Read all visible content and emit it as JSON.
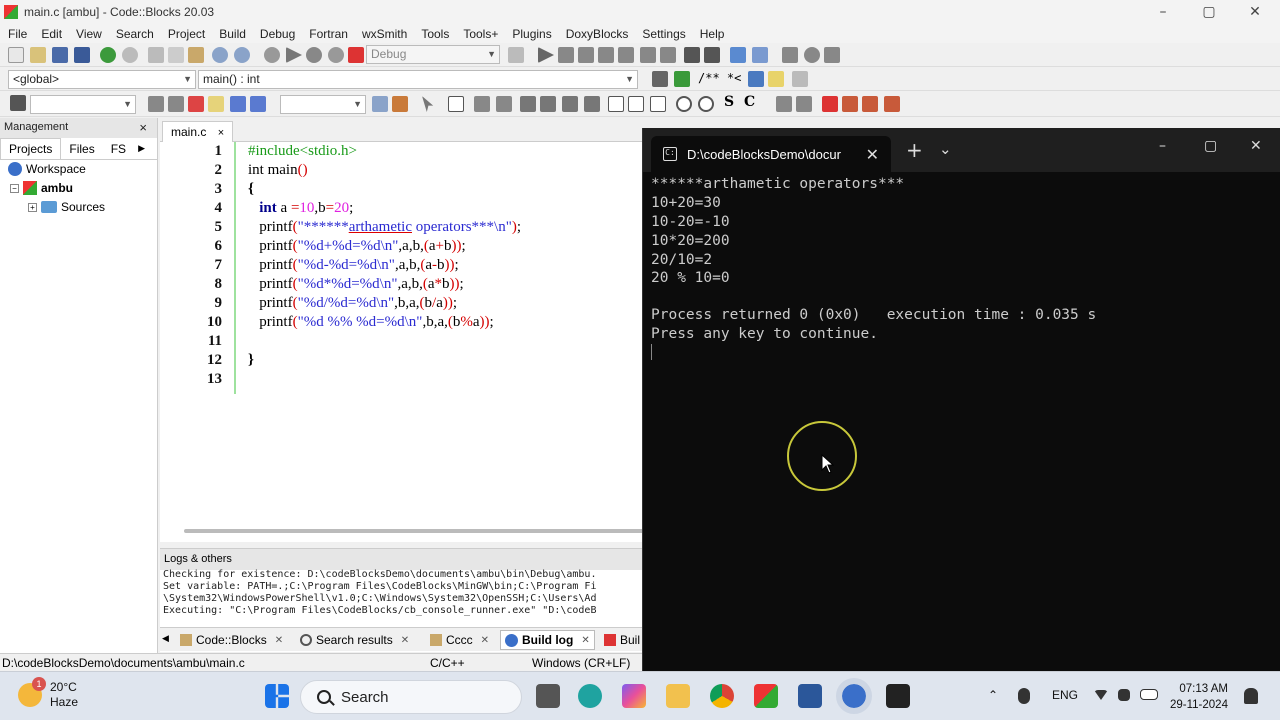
{
  "window": {
    "title": "main.c [ambu] - Code::Blocks 20.03",
    "controls": [
      "–",
      "▢",
      "✕"
    ]
  },
  "menu": [
    "File",
    "Edit",
    "View",
    "Search",
    "Project",
    "Build",
    "Debug",
    "Fortran",
    "wxSmith",
    "Tools",
    "Tools+",
    "Plugins",
    "DoxyBlocks",
    "Settings",
    "Help"
  ],
  "toolbar": {
    "build_target": "Debug",
    "scope": "<global>",
    "function": "main() : int",
    "doxy_comment": "/** *<",
    "search_value": "",
    "find_value": "",
    "s_label": "S",
    "c_label": "C"
  },
  "management": {
    "title": "Management",
    "close": "×",
    "tabs": [
      "Projects",
      "Files",
      "FS"
    ],
    "tree": {
      "workspace": "Workspace",
      "project": "ambu",
      "folder": "Sources"
    }
  },
  "editor": {
    "tab_name": "main.c",
    "tab_close": "×",
    "line_numbers": [
      "1",
      "2",
      "3",
      "4",
      "5",
      "6",
      "7",
      "8",
      "9",
      "10",
      "11",
      "12",
      "13"
    ]
  },
  "logs": {
    "title": "Logs & others",
    "lines": [
      "Checking for existence: D:\\codeBlocksDemo\\documents\\ambu\\bin\\Debug\\ambu.",
      "Set variable: PATH=.;C:\\Program Files\\CodeBlocks\\MinGW\\bin;C:\\Program Fi",
      "\\System32\\WindowsPowerShell\\v1.0;C:\\Windows\\System32\\OpenSSH;C:\\Users\\Ad",
      "Executing: \"C:\\Program Files\\CodeBlocks/cb_console_runner.exe\" \"D:\\codeB"
    ],
    "tabs": [
      "Code::Blocks",
      "Search results",
      "Cccc",
      "Build log",
      "Buil"
    ]
  },
  "status": {
    "path": "D:\\codeBlocksDemo\\documents\\ambu\\main.c",
    "language": "C/C++",
    "eol": "Windows (CR+LF)"
  },
  "terminal": {
    "tab_title": "D:\\codeBlocksDemo\\docur",
    "tab_close": "✕",
    "new_tab": "+",
    "dropdown": "⌄",
    "controls": [
      "–",
      "▢",
      "✕"
    ],
    "lines": [
      "******arthametic operators***",
      "10+20=30",
      "10-20=-10",
      "10*20=200",
      "20/10=2",
      "20 % 10=0",
      "",
      "Process returned 0 (0x0)   execution time : 0.035 s",
      "Press any key to continue."
    ]
  },
  "taskbar": {
    "weather_temp": "20°C",
    "weather_desc": "Haze",
    "weather_badge": "1",
    "search_label": "Search",
    "lang": "ENG",
    "time": "07:13 AM",
    "date": "29-11-2024"
  },
  "colors": {
    "keyword": "#00008b",
    "preprocessor": "#1a9b1a",
    "string": "#2b2bd1",
    "number": "#e020e0",
    "operator": "#d40000",
    "terminal_bg": "#0c0c0c"
  }
}
